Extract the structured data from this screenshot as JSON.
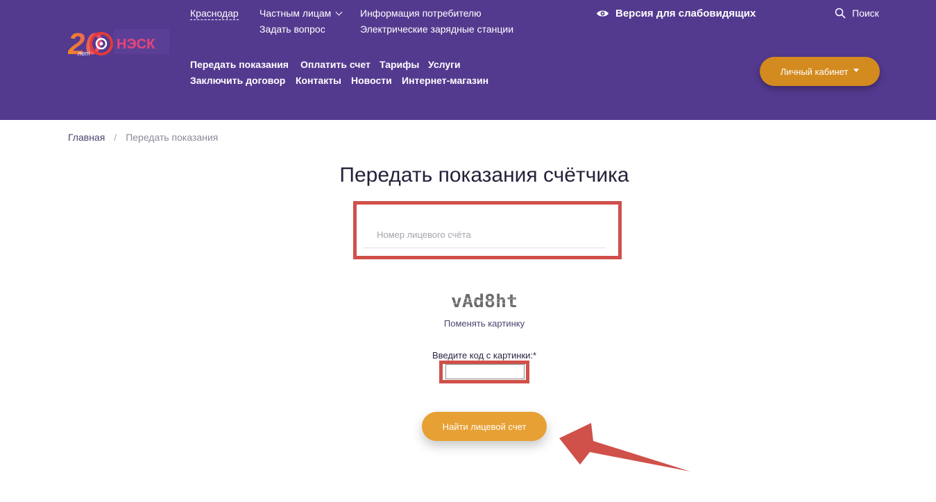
{
  "header": {
    "logo": {
      "number": "20",
      "sub": "лет",
      "brand": "НЭСК"
    },
    "city": "Краснодар",
    "top_links": {
      "private": "Частным лицам",
      "ask": "Задать вопрос",
      "consumer_info": "Информация потребителю",
      "charging": "Электрические зарядные станции"
    },
    "accessibility": "Версия для слабовидящих",
    "search": "Поиск",
    "nav": [
      "Передать показания",
      "Оплатить счет",
      "Тарифы",
      "Услуги",
      "Заключить договор",
      "Контакты",
      "Новости",
      "Интернет-магазин"
    ],
    "cabinet": "Личный кабинет"
  },
  "breadcrumb": {
    "home": "Главная",
    "separator": "/",
    "current": "Передать показания"
  },
  "main": {
    "title": "Передать показания счётчика",
    "account_placeholder": "Номер лицевого счёта",
    "captcha_text": "vAd8ht",
    "change_picture": "Поменять картинку",
    "code_label": "Введите код с картинки:*",
    "submit": "Найти лицевой счет"
  },
  "colors": {
    "header_bg": "#543a8f",
    "cabinet_button": "#d38a1f",
    "submit_button": "#e7a033",
    "annotation_red": "#d0504a",
    "logo_red": "#e23b3b",
    "logo_orange": "#f08a24",
    "logo_pink": "#e8457a"
  },
  "icons": [
    "eye-icon",
    "search-icon",
    "chevron-down-icon",
    "caret-down-icon",
    "annotation-arrow-icon"
  ]
}
